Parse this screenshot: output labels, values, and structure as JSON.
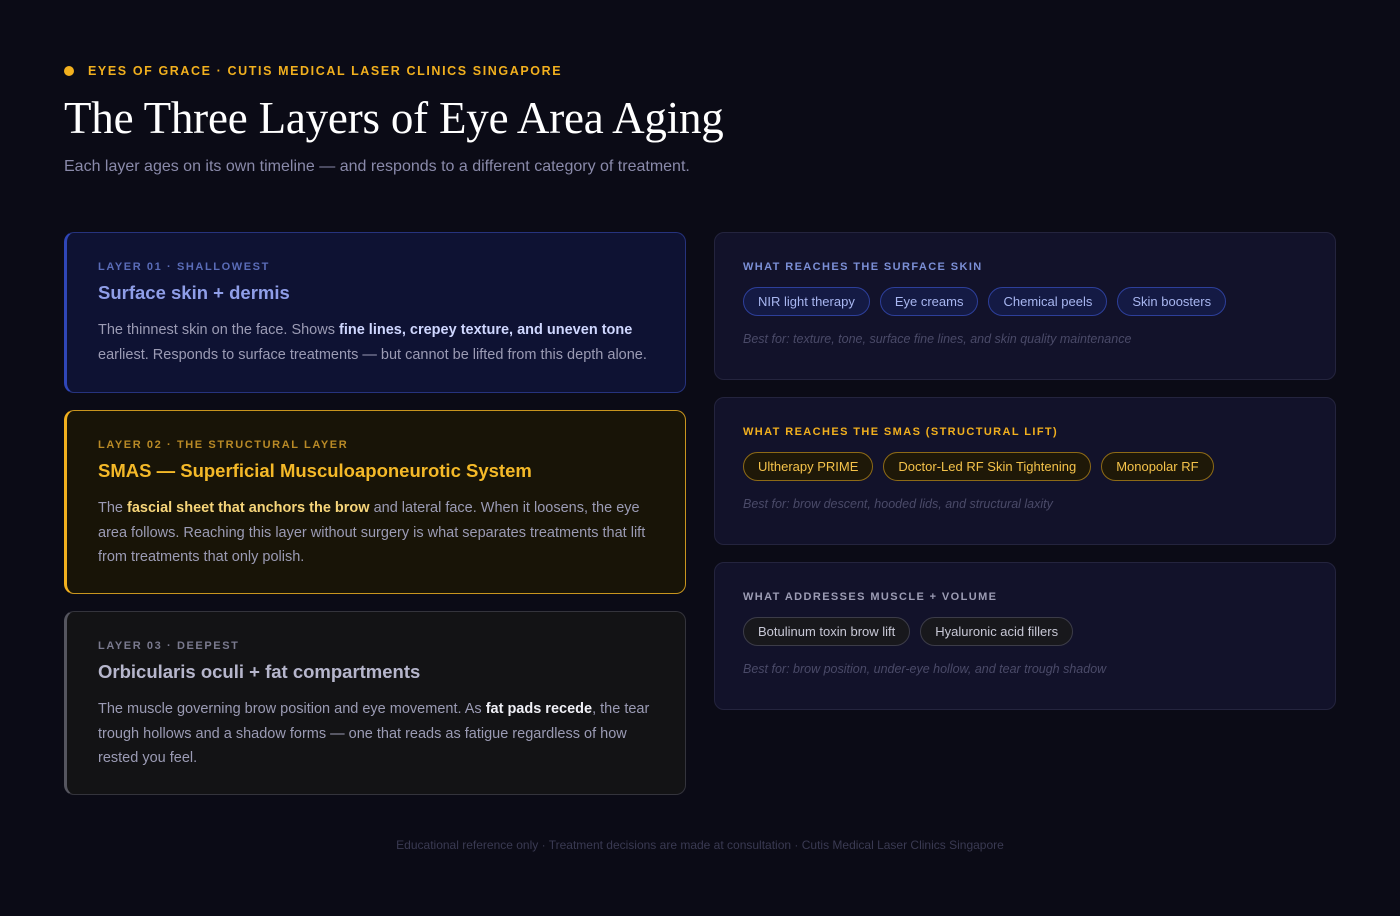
{
  "header": {
    "eyebrow": "EYES OF GRACE · CUTIS MEDICAL LASER CLINICS SINGAPORE",
    "title": "The Three Layers of Eye Area Aging",
    "subtitle": "Each layer ages on its own timeline — and responds to a different category of treatment."
  },
  "layers": [
    {
      "tag": "LAYER 01 · SHALLOWEST",
      "title": "Surface skin + dermis",
      "body_pre": "The thinnest skin on the face. Shows ",
      "body_strong": "fine lines, crepey texture, and uneven tone",
      "body_post": " earliest. Responds to surface treatments — but cannot be lifted from this depth alone."
    },
    {
      "tag": "LAYER 02 · THE STRUCTURAL LAYER",
      "title": "SMAS — Superficial Musculoaponeurotic System",
      "body_pre": "The ",
      "body_strong": "fascial sheet that anchors the brow",
      "body_post": " and lateral face. When it loosens, the eye area follows. Reaching this layer without surgery is what separates treatments that lift from treatments that only polish."
    },
    {
      "tag": "LAYER 03 · DEEPEST",
      "title": "Orbicularis oculi + fat compartments",
      "body_pre": "The muscle governing brow position and eye movement. As ",
      "body_strong": "fat pads recede",
      "body_post": ", the tear trough hollows and a shadow forms — one that reads as fatigue regardless of how rested you feel."
    }
  ],
  "reach": [
    {
      "label": "WHAT REACHES THE SURFACE SKIN",
      "chips": [
        "NIR light therapy",
        "Eye creams",
        "Chemical peels",
        "Skin boosters"
      ],
      "best_for": "Best for: texture, tone, surface fine lines, and skin quality maintenance"
    },
    {
      "label": "WHAT REACHES THE SMAS (STRUCTURAL LIFT)",
      "chips": [
        "Ultherapy PRIME",
        "Doctor-Led RF Skin Tightening",
        "Monopolar RF"
      ],
      "best_for": "Best for: brow descent, hooded lids, and structural laxity"
    },
    {
      "label": "WHAT ADDRESSES MUSCLE + VOLUME",
      "chips": [
        "Botulinum toxin brow lift",
        "Hyaluronic acid fillers"
      ],
      "best_for": "Best for: brow position, under-eye hollow, and tear trough shadow"
    }
  ],
  "footer": {
    "text": "Educational reference only · Treatment decisions are made at consultation · Cutis Medical Laser Clinics Singapore"
  },
  "colors": {
    "accent_gold": "#f2b01e",
    "accent_blue": "#2f46b8",
    "background": "#0b0b16"
  }
}
